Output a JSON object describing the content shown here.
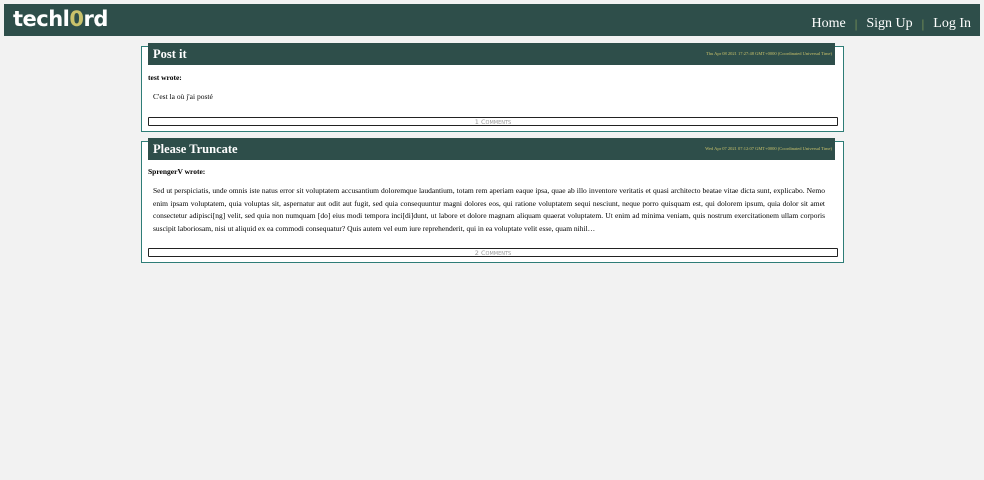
{
  "header": {
    "logo_prefix": "techl",
    "logo_accent": "0",
    "logo_suffix": "rd",
    "nav": {
      "home": "Home",
      "signup": "Sign Up",
      "login": "Log In",
      "separator": "|"
    }
  },
  "posts": [
    {
      "title": "Post it",
      "date": "Thu Apr 08 2021 17:27:48 GMT+0000 (Coordinated Universal Time)",
      "author_line": "test wrote:",
      "body": "C'est la où j'ai posté",
      "comments_label": "1 Comments"
    },
    {
      "title": "Please Truncate",
      "date": "Wed Apr 07 2021 07:12:07 GMT+0000 (Coordinated Universal Time)",
      "author_line": "SprengerV wrote:",
      "body": "Sed ut perspiciatis, unde omnis iste natus error sit voluptatem accusantium doloremque laudantium, totam rem aperiam eaque ipsa, quae ab illo inventore veritatis et quasi architecto beatae vitae dicta sunt, explicabo. Nemo enim ipsam voluptatem, quia voluptas sit, aspernatur aut odit aut fugit, sed quia consequuntur magni dolores eos, qui ratione voluptatem sequi nesciunt, neque porro quisquam est, qui dolorem ipsum, quia dolor sit amet consectetur adipisci[ng] velit, sed quia non numquam [do] eius modi tempora inci[di]dunt, ut labore et dolore magnam aliquam quaerat voluptatem. Ut enim ad minima veniam, quis nostrum exercitationem ullam corporis suscipit laboriosam, nisi ut aliquid ex ea commodi consequatur? Quis autem vel eum iure reprehenderit, qui in ea voluptate velit esse, quam nihil…",
      "comments_label": "2 Comments"
    }
  ]
}
